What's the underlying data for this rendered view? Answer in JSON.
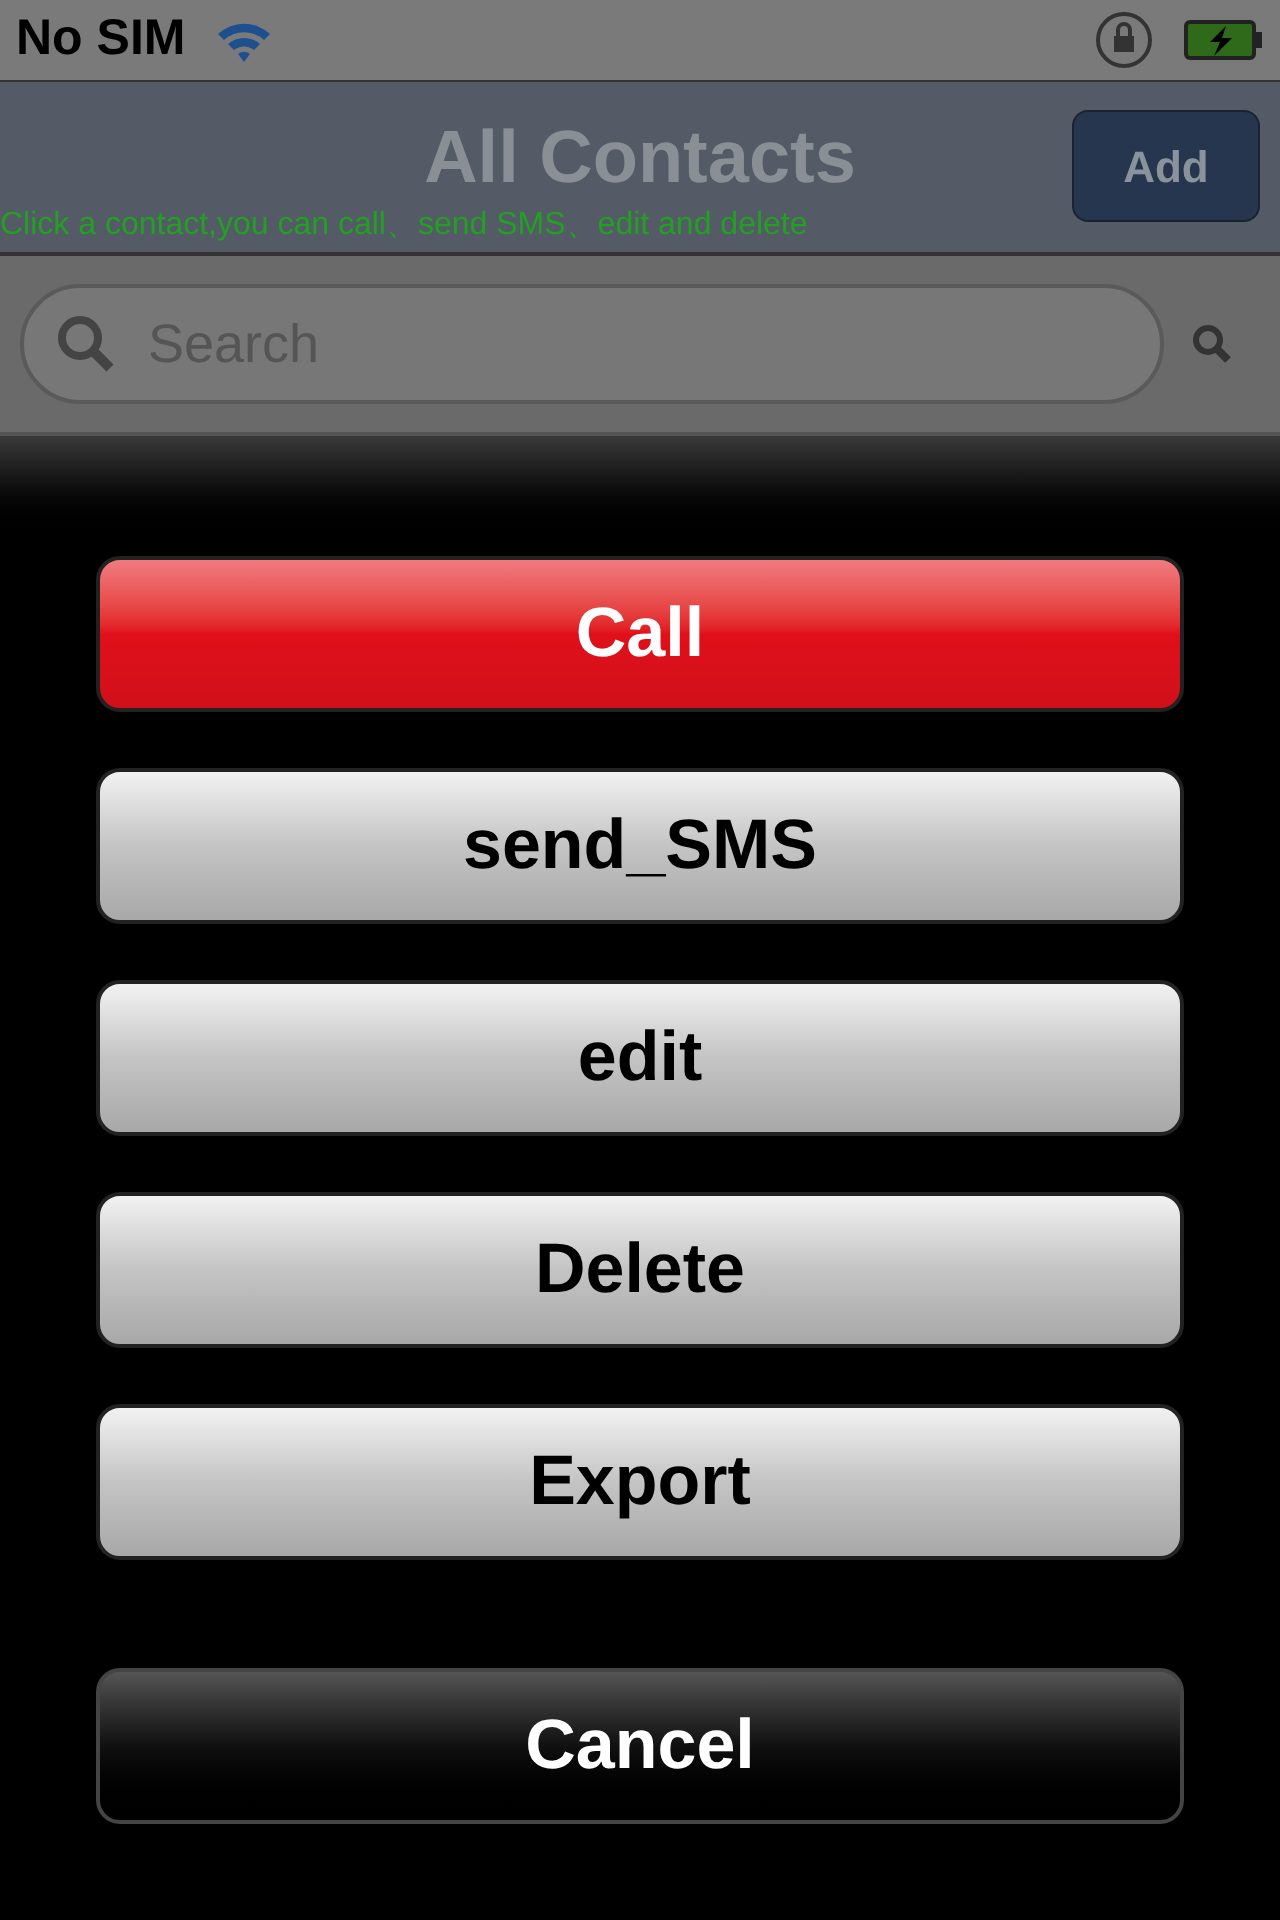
{
  "status_bar": {
    "carrier": "No SIM"
  },
  "nav_bar": {
    "title": "All Contacts",
    "add_button": "Add",
    "hint": "Click a contact,you can call、send SMS、edit and delete"
  },
  "search": {
    "placeholder": "Search"
  },
  "action_sheet": {
    "buttons": [
      {
        "label": "Call",
        "kind": "destructive"
      },
      {
        "label": "send_SMS",
        "kind": "default"
      },
      {
        "label": "edit",
        "kind": "default"
      },
      {
        "label": "Delete",
        "kind": "default"
      },
      {
        "label": "Export",
        "kind": "default"
      },
      {
        "label": "Cancel",
        "kind": "cancel"
      }
    ]
  }
}
